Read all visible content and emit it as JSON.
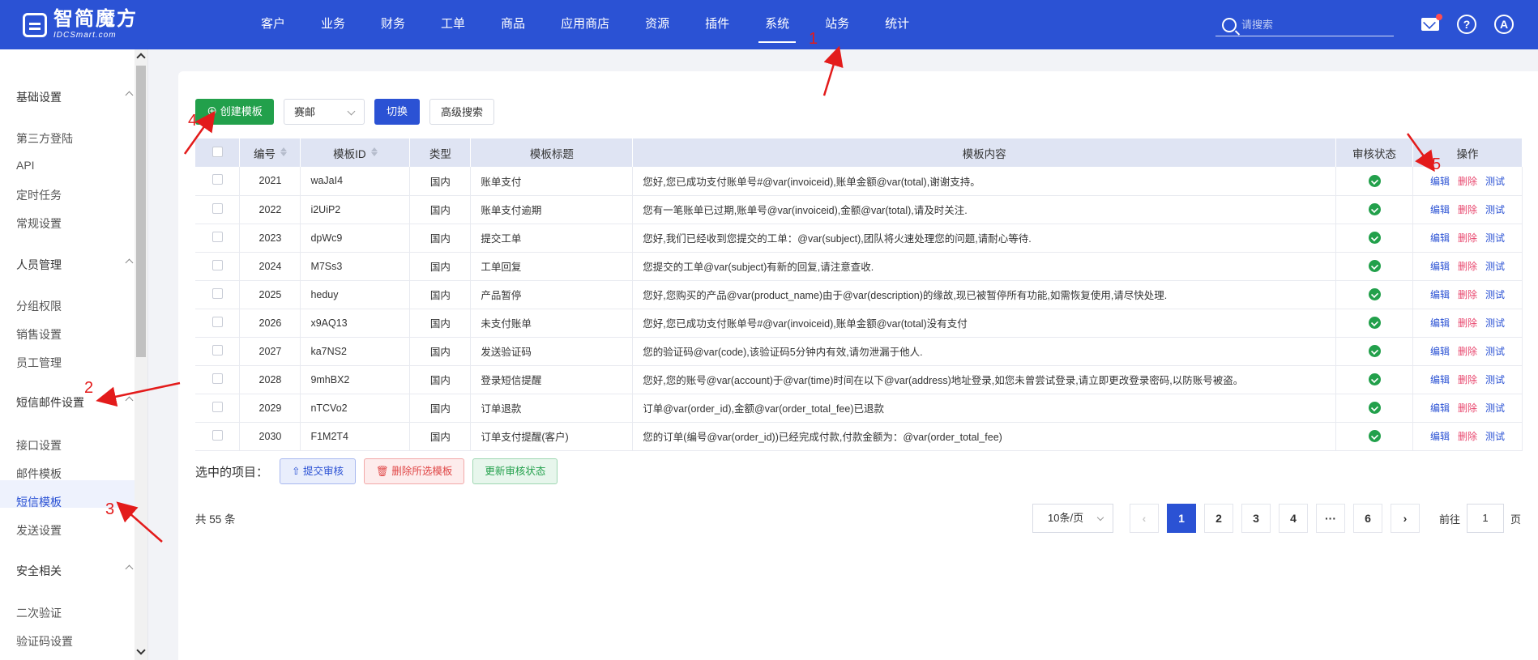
{
  "header": {
    "logo_main": "智简魔方",
    "logo_sub": "IDCSmart.com",
    "nav": [
      "客户",
      "业务",
      "财务",
      "工单",
      "商品",
      "应用商店",
      "资源",
      "插件",
      "系统",
      "站务",
      "统计"
    ],
    "active_nav": "系统",
    "search_placeholder": "请搜索",
    "avatar_letter": "A",
    "help_glyph": "?"
  },
  "sidebar": {
    "groups": [
      {
        "title": "基础设置",
        "items": [
          "第三方登陆",
          "API",
          "定时任务",
          "常规设置"
        ]
      },
      {
        "title": "人员管理",
        "items": [
          "分组权限",
          "销售设置",
          "员工管理"
        ]
      },
      {
        "title": "短信邮件设置",
        "items": [
          "接口设置",
          "邮件模板",
          "短信模板",
          "发送设置"
        ]
      },
      {
        "title": "安全相关",
        "items": [
          "二次验证",
          "验证码设置"
        ]
      }
    ],
    "active_item": "短信模板"
  },
  "toolbar": {
    "create_label": "创建模板",
    "select_value": "赛邮",
    "switch_label": "切换",
    "advanced_label": "高级搜索"
  },
  "table": {
    "headers": [
      "编号",
      "模板ID",
      "类型",
      "模板标题",
      "模板内容",
      "审核状态",
      "操作"
    ],
    "rows": [
      {
        "id": "2021",
        "tid": "waJaI4",
        "type": "国内",
        "title": "账单支付",
        "content": "您好,您已成功支付账单号#@var(invoiceid),账单金额@var(total),谢谢支持。"
      },
      {
        "id": "2022",
        "tid": "i2UiP2",
        "type": "国内",
        "title": "账单支付逾期",
        "content": "您有一笔账单已过期,账单号@var(invoiceid),金额@var(total),请及时关注."
      },
      {
        "id": "2023",
        "tid": "dpWc9",
        "type": "国内",
        "title": "提交工单",
        "content": "您好,我们已经收到您提交的工单：@var(subject),团队将火速处理您的问题,请耐心等待."
      },
      {
        "id": "2024",
        "tid": "M7Ss3",
        "type": "国内",
        "title": "工单回复",
        "content": "您提交的工单@var(subject)有新的回复,请注意查收."
      },
      {
        "id": "2025",
        "tid": "heduy",
        "type": "国内",
        "title": "产品暂停",
        "content": "您好,您购买的产品@var(product_name)由于@var(description)的缘故,现已被暂停所有功能,如需恢复使用,请尽快处理."
      },
      {
        "id": "2026",
        "tid": "x9AQ13",
        "type": "国内",
        "title": "未支付账单",
        "content": "您好,您已成功支付账单号#@var(invoiceid),账单金额@var(total)没有支付"
      },
      {
        "id": "2027",
        "tid": "ka7NS2",
        "type": "国内",
        "title": "发送验证码",
        "content": "您的验证码@var(code),该验证码5分钟内有效,请勿泄漏于他人."
      },
      {
        "id": "2028",
        "tid": "9mhBX2",
        "type": "国内",
        "title": "登录短信提醒",
        "content": "您好,您的账号@var(account)于@var(time)时间在以下@var(address)地址登录,如您未曾尝试登录,请立即更改登录密码,以防账号被盗。"
      },
      {
        "id": "2029",
        "tid": "nTCVo2",
        "type": "国内",
        "title": "订单退款",
        "content": "订单@var(order_id),金额@var(order_total_fee)已退款"
      },
      {
        "id": "2030",
        "tid": "F1M2T4",
        "type": "国内",
        "title": "订单支付提醒(客户)",
        "content": "您的订单(编号@var(order_id))已经完成付款,付款金额为：@var(order_total_fee)"
      }
    ],
    "ops": {
      "edit": "编辑",
      "delete": "删除",
      "test": "测试"
    }
  },
  "batch": {
    "label": "选中的项目：",
    "submit_label": "提交审核",
    "delete_label": "删除所选模板",
    "update_label": "更新审核状态"
  },
  "pagination": {
    "total": "共 55 条",
    "page_size": "10条/页",
    "pages": [
      "1",
      "2",
      "3",
      "4",
      "···",
      "6"
    ],
    "current": "1",
    "goto_prefix": "前往",
    "goto_value": "1",
    "goto_suffix": "页"
  },
  "annotations": [
    "1",
    "2",
    "3",
    "4",
    "5"
  ],
  "colors": {
    "primary": "#2b52d4",
    "success": "#22a04b",
    "danger": "#e8466d",
    "annotation": "#e31b1b"
  }
}
